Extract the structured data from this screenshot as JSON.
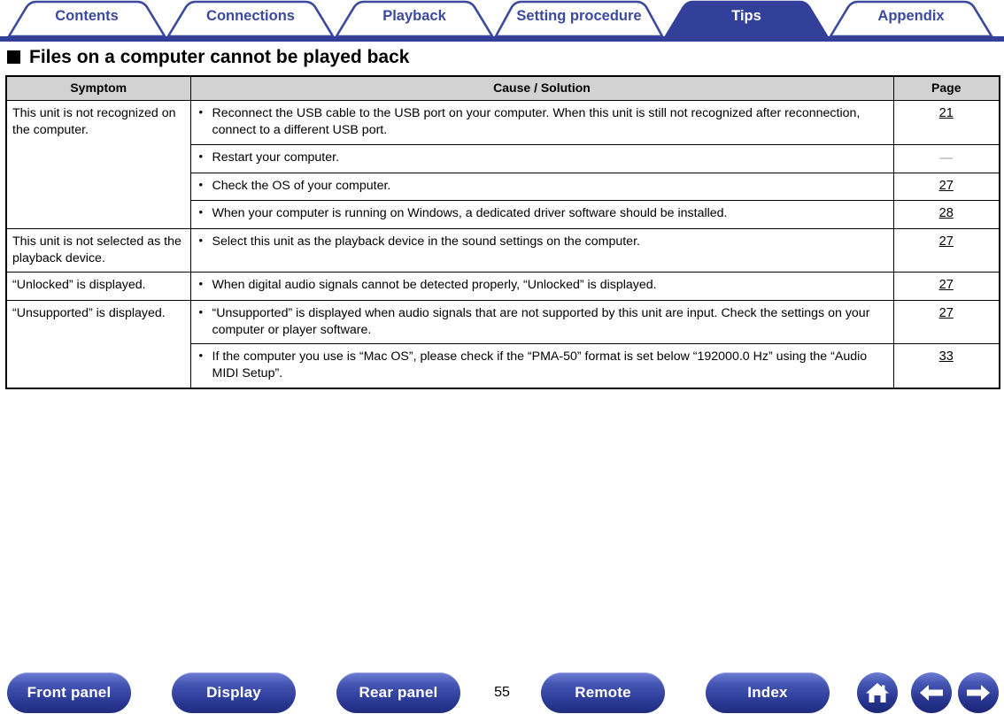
{
  "nav_tabs": {
    "items": [
      {
        "label": "Contents",
        "active": false
      },
      {
        "label": "Connections",
        "active": false
      },
      {
        "label": "Playback",
        "active": false
      },
      {
        "label": "Setting procedure",
        "active": false
      },
      {
        "label": "Tips",
        "active": true
      },
      {
        "label": "Appendix",
        "active": false
      }
    ],
    "accent_color": "#32409a",
    "label_color": "#3b4a9e",
    "active_label_color": "#ffffff"
  },
  "heading": {
    "bullet": "black-square",
    "text": "Files on a computer cannot be played back"
  },
  "table": {
    "columns": [
      "Symptom",
      "Cause / Solution",
      "Page"
    ],
    "header_background": "#d2d2d2",
    "rows": [
      {
        "symptom": "This unit is not recognized on the computer.",
        "symptom_rowspan": 4,
        "cause": "Reconnect the USB cable to the USB port on your computer. When this unit is still not recognized after reconnection, connect to a different USB port.",
        "page": "21",
        "page_is_link": true
      },
      {
        "symptom": "",
        "cause": "Restart your computer.",
        "page": "—",
        "page_is_link": false
      },
      {
        "symptom": "",
        "cause": "Check the OS of your computer.",
        "page": "27",
        "page_is_link": true
      },
      {
        "symptom": "",
        "cause": "When your computer is running on Windows, a dedicated driver software should be installed.",
        "page": "28",
        "page_is_link": true
      },
      {
        "symptom": "This unit is not selected as the playback device.",
        "symptom_rowspan": 1,
        "cause": "Select this unit as the playback device in the sound settings on the computer.",
        "page": "27",
        "page_is_link": true
      },
      {
        "symptom": "“Unlocked” is displayed.",
        "symptom_rowspan": 1,
        "cause": "When digital audio signals cannot be detected properly, “Unlocked” is displayed.",
        "page": "27",
        "page_is_link": true
      },
      {
        "symptom": "“Unsupported” is displayed.",
        "symptom_rowspan": 2,
        "cause": "“Unsupported” is displayed when audio signals that are not supported by this unit are input. Check the settings on your computer or player software.",
        "page": "27",
        "page_is_link": true
      },
      {
        "symptom": "",
        "cause": "If the computer you use is “Mac OS”, please check if the “PMA-50” format is set below “192000.0 Hz” using the “Audio MIDI Setup”.",
        "page": "33",
        "page_is_link": true
      }
    ]
  },
  "footer": {
    "buttons": [
      {
        "label": "Front panel"
      },
      {
        "label": "Display"
      },
      {
        "label": "Rear panel"
      },
      {
        "label": "Remote"
      },
      {
        "label": "Index"
      }
    ],
    "page_number": "55",
    "icon_buttons": [
      {
        "name": "home-icon"
      },
      {
        "name": "arrow-left-icon"
      },
      {
        "name": "arrow-right-icon"
      }
    ]
  }
}
